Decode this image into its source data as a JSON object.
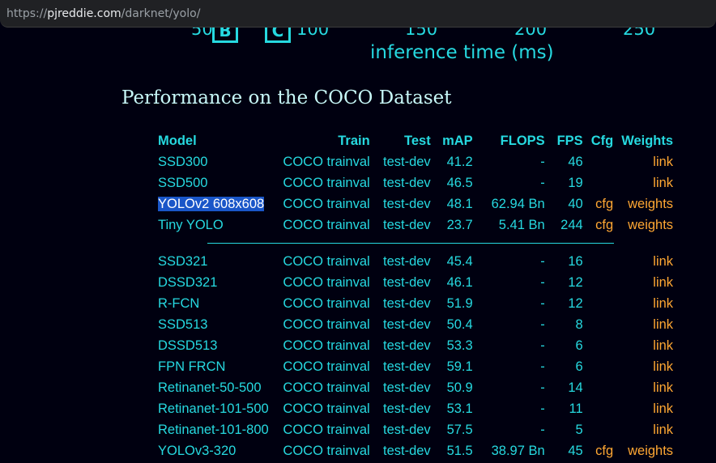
{
  "browser": {
    "url_prefix": "https://",
    "url_domain": "pjreddie.com",
    "url_path": "/darknet/yolo/"
  },
  "chart_fragment": {
    "ticks": [
      "50",
      "100",
      "150",
      "200",
      "250"
    ],
    "markers": [
      "B",
      "C"
    ],
    "xlabel": "inference time (ms)"
  },
  "section": {
    "title": "Performance on the COCO Dataset"
  },
  "table": {
    "headers": {
      "model": "Model",
      "train": "Train",
      "test": "Test",
      "map": "mAP",
      "flops": "FLOPS",
      "fps": "FPS",
      "cfg": "Cfg",
      "weights": "Weights"
    },
    "group1": [
      {
        "model": "SSD300",
        "train": "COCO trainval",
        "test": "test-dev",
        "map": "41.2",
        "flops": "-",
        "fps": "46",
        "cfg": "",
        "weights": "link"
      },
      {
        "model": "SSD500",
        "train": "COCO trainval",
        "test": "test-dev",
        "map": "46.5",
        "flops": "-",
        "fps": "19",
        "cfg": "",
        "weights": "link"
      },
      {
        "model": "YOLOv2 608x608",
        "train": "COCO trainval",
        "test": "test-dev",
        "map": "48.1",
        "flops": "62.94 Bn",
        "fps": "40",
        "cfg": "cfg",
        "weights": "weights"
      },
      {
        "model": "Tiny YOLO",
        "train": "COCO trainval",
        "test": "test-dev",
        "map": "23.7",
        "flops": "5.41 Bn",
        "fps": "244",
        "cfg": "cfg",
        "weights": "weights"
      }
    ],
    "group2": [
      {
        "model": "SSD321",
        "train": "COCO trainval",
        "test": "test-dev",
        "map": "45.4",
        "flops": "-",
        "fps": "16",
        "cfg": "",
        "weights": "link"
      },
      {
        "model": "DSSD321",
        "train": "COCO trainval",
        "test": "test-dev",
        "map": "46.1",
        "flops": "-",
        "fps": "12",
        "cfg": "",
        "weights": "link"
      },
      {
        "model": "R-FCN",
        "train": "COCO trainval",
        "test": "test-dev",
        "map": "51.9",
        "flops": "-",
        "fps": "12",
        "cfg": "",
        "weights": "link"
      },
      {
        "model": "SSD513",
        "train": "COCO trainval",
        "test": "test-dev",
        "map": "50.4",
        "flops": "-",
        "fps": "8",
        "cfg": "",
        "weights": "link"
      },
      {
        "model": "DSSD513",
        "train": "COCO trainval",
        "test": "test-dev",
        "map": "53.3",
        "flops": "-",
        "fps": "6",
        "cfg": "",
        "weights": "link"
      },
      {
        "model": "FPN FRCN",
        "train": "COCO trainval",
        "test": "test-dev",
        "map": "59.1",
        "flops": "-",
        "fps": "6",
        "cfg": "",
        "weights": "link"
      },
      {
        "model": "Retinanet-50-500",
        "train": "COCO trainval",
        "test": "test-dev",
        "map": "50.9",
        "flops": "-",
        "fps": "14",
        "cfg": "",
        "weights": "link"
      },
      {
        "model": "Retinanet-101-500",
        "train": "COCO trainval",
        "test": "test-dev",
        "map": "53.1",
        "flops": "-",
        "fps": "11",
        "cfg": "",
        "weights": "link"
      },
      {
        "model": "Retinanet-101-800",
        "train": "COCO trainval",
        "test": "test-dev",
        "map": "57.5",
        "flops": "-",
        "fps": "5",
        "cfg": "",
        "weights": "link"
      },
      {
        "model": "YOLOv3-320",
        "train": "COCO trainval",
        "test": "test-dev",
        "map": "51.5",
        "flops": "38.97 Bn",
        "fps": "45",
        "cfg": "cfg",
        "weights": "weights"
      }
    ],
    "selected_text": "YOLOv2 608x608"
  },
  "colors": {
    "background": "#000010",
    "text_cyan": "#26d9e0",
    "link_orange": "#ffa733",
    "selection": "#1a56c8"
  }
}
